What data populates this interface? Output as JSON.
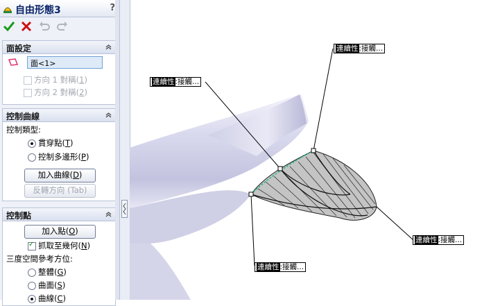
{
  "window": {
    "title": "自由形態3",
    "help": "?"
  },
  "toolbar": {
    "ok": "ok-checkmark",
    "cancel": "cancel-x",
    "undo": "undo",
    "redo": "redo"
  },
  "face_settings": {
    "header": "面設定",
    "face_value": "面<1>",
    "dir1_label": "方向 1 對稱(",
    "dir1_key": "1",
    "dir1_end": ")",
    "dir2_label": "方向 2 對稱(",
    "dir2_key": "2",
    "dir2_end": ")"
  },
  "control_curves": {
    "header": "控制曲線",
    "type_label": "控制類型:",
    "through_points": "貫穿點(",
    "through_key": "T",
    "control_polygon": "控制多邊形(",
    "polygon_key": "P",
    "add_curve": "加入曲線(",
    "add_curve_key": "D",
    "flip_direction": "反轉方向 (Tab)",
    "selected": "through_points"
  },
  "control_points": {
    "header": "控制點",
    "add_point": "加入點(",
    "add_point_key": "O",
    "snap_geometry": "抓取至幾何(",
    "snap_key": "N",
    "triad_label": "三度空間參考方位:",
    "global": "整體(",
    "global_key": "G",
    "surface": "曲面(",
    "surface_key": "S",
    "curve": "曲線(",
    "curve_key": "C",
    "close_paren": ")",
    "snap_checked": true,
    "triad_selected": "curve"
  },
  "callouts": [
    {
      "prefix": "連續性",
      "sep": ":",
      "value": "接觸..."
    },
    {
      "prefix": "連續性",
      "sep": ":",
      "value": "接觸..."
    },
    {
      "prefix": "連續性",
      "sep": ":",
      "value": "接觸..."
    },
    {
      "prefix": "連續性",
      "sep": ":",
      "value": "接觸..."
    }
  ],
  "colors": {
    "accent_blue": "#0a246a",
    "ok_green": "#1a9a1a",
    "cancel_red": "#cc1010",
    "edge_green": "#2db88a"
  }
}
